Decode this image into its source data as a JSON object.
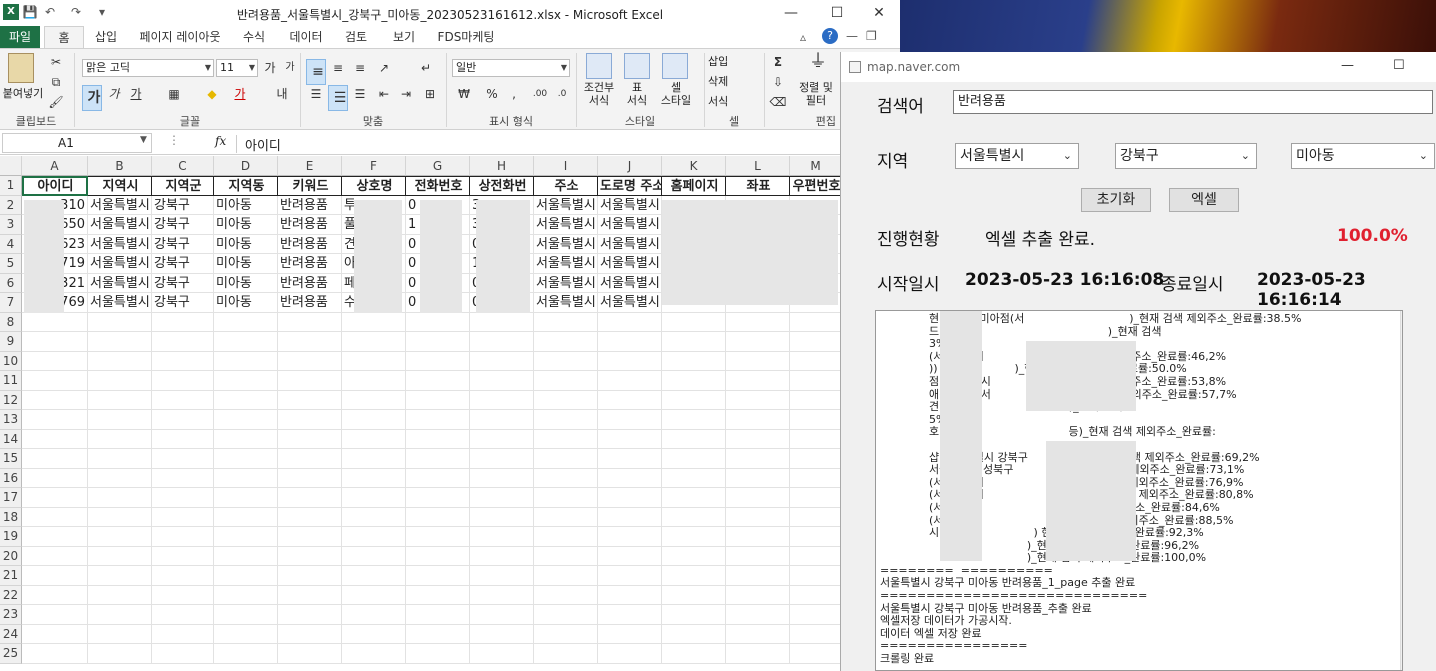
{
  "excel": {
    "title": "반려용품_서울특별시_강북구_미아동_20230523161612.xlsx  -  Microsoft Excel",
    "window_controls": {
      "minimize": "—",
      "maximize": "☐",
      "close": "✕"
    },
    "tabs": [
      "파일",
      "홈",
      "삽입",
      "페이지 레이아웃",
      "수식",
      "데이터",
      "검토",
      "보기",
      "FDS마케팅"
    ],
    "ribbon": {
      "paste_label": "붙여넣기",
      "font_name": "맑은 고딕",
      "font_size": "11",
      "number_format": "일반",
      "cond_format": "조건부\n서식",
      "table_format": "표\n서식",
      "cell_style": "셀\n스타일",
      "insert": "삽입",
      "delete": "삭제",
      "format": "서식",
      "sort_filter": "정렬 및\n필터",
      "groups": [
        "클립보드",
        "글꼴",
        "맞춤",
        "표시 형식",
        "스타일",
        "셀",
        "편집"
      ]
    },
    "name_box": "A1",
    "fx": "fx",
    "formula_value": "아이디",
    "columns": [
      "A",
      "B",
      "C",
      "D",
      "E",
      "F",
      "G",
      "H",
      "I",
      "J",
      "K",
      "L",
      "M"
    ],
    "headers": [
      "아이디",
      "지역시",
      "지역군",
      "지역동",
      "키워드",
      "상호명",
      "전화번호",
      "상전화번",
      "주소",
      "도로명 주소",
      "홈페이지",
      "좌표",
      "우편번호"
    ],
    "rows": [
      [
        "310",
        "서울특별시",
        "강북구",
        "미아동",
        "반려용품",
        "투",
        "0",
        "3",
        "서울특별시",
        "서울특별시",
        "",
        "",
        ""
      ],
      [
        "650",
        "서울특별시",
        "강북구",
        "미아동",
        "반려용품",
        "풀",
        "1",
        "3",
        "서울특별시",
        "서울특별시",
        "",
        "",
        ""
      ],
      [
        "623",
        "서울특별시",
        "강북구",
        "미아동",
        "반려용품",
        "견",
        "0",
        "0",
        "서울특별시",
        "서울특별시",
        "",
        "",
        ""
      ],
      [
        "719",
        "서울특별시",
        "강북구",
        "미아동",
        "반려용품",
        "아",
        "0",
        "1",
        "서울특별시",
        "서울특별시",
        "",
        "",
        ""
      ],
      [
        "321",
        "서울특별시",
        "강북구",
        "미아동",
        "반려용품",
        "페",
        "0",
        "0",
        "서울특별시",
        "서울특별시",
        "",
        "",
        ""
      ],
      [
        "769",
        "서울특별시",
        "강북구",
        "미아동",
        "반려용품",
        "수",
        "0",
        "0",
        "서울특별시",
        "서울특별시",
        "",
        "",
        ""
      ]
    ],
    "row_numbers": [
      "1",
      "2",
      "3",
      "4",
      "5",
      "6",
      "7",
      "8",
      "9",
      "10",
      "11",
      "12",
      "13",
      "14",
      "15",
      "16",
      "17",
      "18",
      "19",
      "20",
      "21",
      "22",
      "23",
      "24",
      "25"
    ]
  },
  "naver": {
    "title": "map.naver.com",
    "search_label": "검색어",
    "search_value": "반려용품",
    "region_label": "지역",
    "si": "서울특별시",
    "gu": "강북구",
    "dong": "미아동",
    "reset_button": "초기화",
    "excel_button": "엑셀",
    "progress_label": "진행현황",
    "progress_status": "엑셀 추출 완료.",
    "progress_pct": "100.0%",
    "start_label": "시작일시",
    "start_value": "2023-05-23 16:16:08",
    "end_label": "종료일시",
    "end_value": "2023-05-23 16:16:14",
    "log": [
      "              현대백화점미아점(서                              )_현재 검색 제외주소_완료률:38.5%",
      "              드(                                               )_현재 검색",
      "              3%",
      "              (서울특별시                    )_현재 검색 제외주소_완료률:46,2%",
      "              ))                      )_현재 검색 제외주소_완료률:50.0%",
      "              점(  울특별시                  )_현재 검색 제외주소_완료률:53,8%",
      "              애견  용실(서                     )_현재 검색 제외주소_완료률:57,7%",
      "              견  실(                               )_현재 검색",
      "              5%",
      "              호                                     등)_현재 검색 제외주소_완료률:",
      "",
      "              샵(서울특별시 강북구                 )_현재 검색 제외주소_완료률:69,2%",
      "              서울특별시 성북구                  _현재 검색 제외주소_완료률:73,1%",
      "              (서울특별시                         )_현재 검색 제외주소_완료률:76,9%",
      "              (서울특별시                         등)_현재 검색 제외주소_완료률:80,8%",
      "              (서울특                        )_현재 검색 제외주소_완료률:84,6%",
      "              (서울특별                         )_현재 검색 제외주소_완료률:88,5%",
      "              시                           ) 현재 검색 제외주소_완료률:92,3%",
      "                                          )_현재 검색 제외주소_완료률:96,2%",
      "                                          )_현재 검색 제외주소_완료률:100,0%",
      "========  ==========",
      "서울특별시 강북구 미아동 반려용품_1_page 추출 완료",
      "=============================",
      "서울특별시 강북구 미아동 반려용품_추출 완료",
      "엑셀저장 데이터가 가공시작.",
      "데이터 엑셀 저장 완료",
      "================",
      "크롤링 완료",
      "================"
    ]
  },
  "colors": {
    "excel_green": "#1e7145",
    "pct_red": "#e0202f"
  }
}
